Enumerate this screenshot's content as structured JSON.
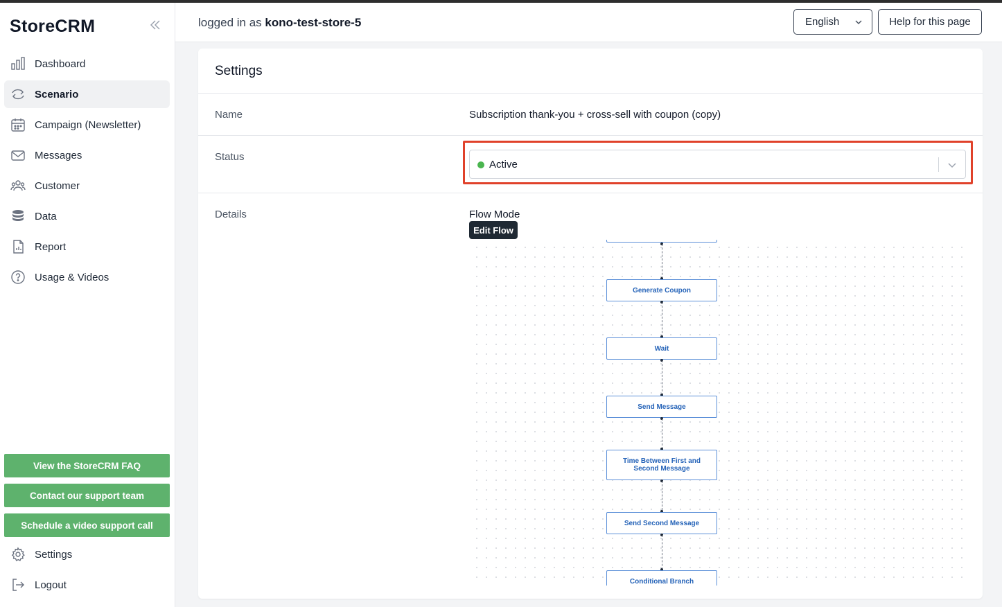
{
  "app": {
    "brand": "StoreCRM"
  },
  "sidebar": {
    "items": [
      {
        "label": "Dashboard",
        "icon": "bar-chart-icon"
      },
      {
        "label": "Scenario",
        "icon": "refresh-icon",
        "active": true
      },
      {
        "label": "Campaign (Newsletter)",
        "icon": "calendar-icon"
      },
      {
        "label": "Messages",
        "icon": "mail-icon"
      },
      {
        "label": "Customer",
        "icon": "users-icon"
      },
      {
        "label": "Data",
        "icon": "database-icon"
      },
      {
        "label": "Report",
        "icon": "report-icon"
      },
      {
        "label": "Usage & Videos",
        "icon": "question-icon"
      }
    ],
    "support_buttons": [
      "View the StoreCRM FAQ",
      "Contact our support team",
      "Schedule a video support call"
    ],
    "bottom_items": [
      {
        "label": "Settings",
        "icon": "gear-icon"
      },
      {
        "label": "Logout",
        "icon": "logout-icon"
      }
    ]
  },
  "header": {
    "logged_in_prefix": "logged in as",
    "store_name": "kono-test-store-5",
    "language": "English",
    "help_label": "Help for this page"
  },
  "settings": {
    "title": "Settings",
    "name_label": "Name",
    "name_value": "Subscription thank-you + cross-sell with coupon (copy)",
    "status_label": "Status",
    "status_value": "Active",
    "status_color": "#4ab54f",
    "details_label": "Details",
    "flow_mode_label": "Flow Mode",
    "edit_flow_label": "Edit Flow"
  },
  "flow": {
    "nodes": [
      "Generate Coupon",
      "Wait",
      "Send Message",
      "Time Between First and Second Message",
      "Send Second Message",
      "Conditional Branch"
    ]
  },
  "colors": {
    "accent_green": "#5eb26d",
    "highlight_red": "#e0412a",
    "flow_blue": "#2563b8"
  }
}
